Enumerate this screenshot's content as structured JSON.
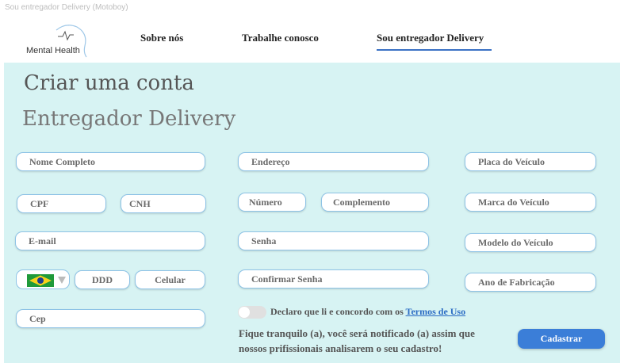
{
  "page": {
    "caption": "Sou entregador Delivery (Motoboy)"
  },
  "header": {
    "logo_text": "Mental Health",
    "nav": [
      {
        "label": "Sobre nós"
      },
      {
        "label": "Trabalhe conosco"
      },
      {
        "label": "Sou entregador Delivery",
        "active": true
      }
    ],
    "accent_color": "#3b72c4"
  },
  "form": {
    "title": "Criar uma conta",
    "subtitle": "Entregador Delivery",
    "background_color": "#d7f3f3",
    "fields": {
      "nome": "Nome Completo",
      "cpf": "CPF",
      "cnh": "CNH",
      "email": "E-mail",
      "ddd": "DDD",
      "celular": "Celular",
      "cep": "Cep",
      "endereco": "Endereço",
      "numero": "Número",
      "complemento": "Complemento",
      "senha": "Senha",
      "confirmar_senha": "Confirmar Senha",
      "placa": "Placa do Veículo",
      "marca": "Marca do Veículo",
      "modelo": "Modelo do Veículo",
      "ano": "Ano de Fabricação"
    },
    "country_select": {
      "flag_icon": "brazil-flag-icon"
    },
    "terms": {
      "text": "Declaro que li e concordo com os",
      "link": "Termos de Uso",
      "checked": false
    },
    "notice_line1": "Fique tranquilo (a), você será notificado (a)  assim que",
    "notice_line2": "nossos prifissionais analisarem o seu cadastro!",
    "submit_label": "Cadastrar",
    "submit_color": "#3b7ed8"
  }
}
